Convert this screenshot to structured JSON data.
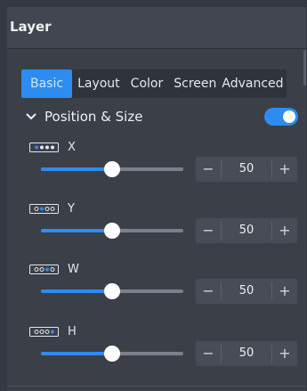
{
  "panel": {
    "title": "Layer"
  },
  "tabs": [
    {
      "label": "Basic",
      "active": true
    },
    {
      "label": "Layout",
      "active": false
    },
    {
      "label": "Color",
      "active": false
    },
    {
      "label": "Screen",
      "active": false
    },
    {
      "label": "Advanced",
      "active": false
    }
  ],
  "section": {
    "title": "Position & Size",
    "expanded": true,
    "enabled": true,
    "chevron_icon": "chevron-down-icon"
  },
  "rows": [
    {
      "letter": "X",
      "icon": "position-x-icon",
      "value": "50",
      "fraction": 0.5
    },
    {
      "letter": "Y",
      "icon": "position-y-icon",
      "value": "50",
      "fraction": 0.5
    },
    {
      "letter": "W",
      "icon": "size-w-icon",
      "value": "50",
      "fraction": 0.5
    },
    {
      "letter": "H",
      "icon": "size-h-icon",
      "value": "50",
      "fraction": 0.5
    }
  ],
  "stepper": {
    "minus": "−",
    "plus": "+"
  },
  "colors": {
    "accent": "#2d8cf0",
    "panel_bg": "#3a3f48",
    "header_bg": "#414651"
  }
}
